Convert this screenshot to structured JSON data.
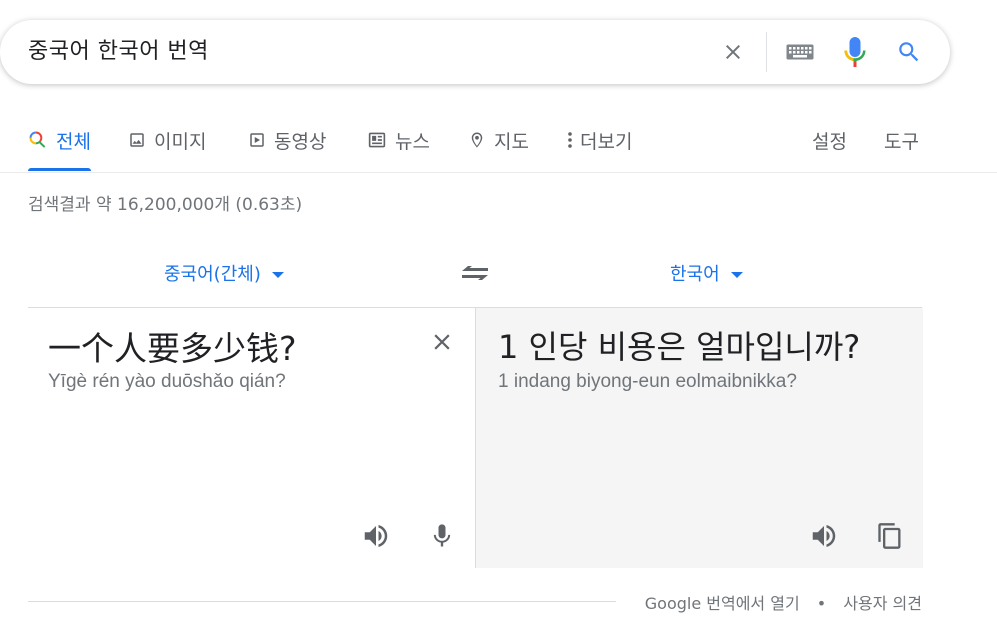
{
  "search": {
    "query": "중국어 한국어 번역",
    "icons": [
      "close-icon",
      "keyboard-icon",
      "microphone-icon",
      "search-icon"
    ]
  },
  "tabs": [
    {
      "label": "전체",
      "icon": "search-icon",
      "active": true
    },
    {
      "label": "이미지",
      "icon": "image-icon"
    },
    {
      "label": "동영상",
      "icon": "play-icon"
    },
    {
      "label": "뉴스",
      "icon": "news-icon"
    },
    {
      "label": "지도",
      "icon": "map-pin-icon"
    },
    {
      "label": "더보기",
      "icon": "more-vert-icon"
    }
  ],
  "tools": {
    "settings": "설정",
    "tools": "도구"
  },
  "result_stats": "검색결과 약 16,200,000개 (0.63초)",
  "translator": {
    "source_lang": "중국어(간체)",
    "target_lang": "한국어",
    "source_text": "一个人要多少钱?",
    "source_romanization": "Yīgè rén yào duōshǎo qián?",
    "target_text": "1 인당 비용은 얼마입니까?",
    "target_romanization": "1 indang biyong-eun eolmaibnikka?"
  },
  "footer": {
    "open_link": "Google 번역에서 열기",
    "separator": "•",
    "feedback_link": "사용자 의견"
  },
  "colors": {
    "accent": "#1a73e8",
    "google_blue": "#4285f4",
    "google_red": "#ea4335",
    "google_yellow": "#fbbc04",
    "google_green": "#34a853",
    "muted": "#70757a",
    "target_panel_bg": "#f5f5f5"
  }
}
